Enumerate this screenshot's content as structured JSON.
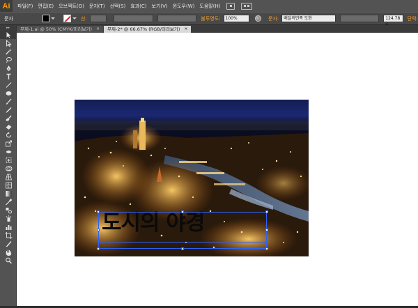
{
  "app": {
    "logo": "Ai",
    "menu": [
      "파일(F)",
      "편집(E)",
      "오브젝트(O)",
      "문자(T)",
      "선택(S)",
      "효과(C)",
      "보기(V)",
      "윈도우(W)",
      "도움말(H)"
    ]
  },
  "control": {
    "mode_label": "문자",
    "stroke_label": "선:",
    "opacity_label": "불투명도:",
    "opacity_value": "100%",
    "char_label": "문자:",
    "font_value": "배달의민족 도현",
    "size_value": "124.78 p",
    "para_label": "단락:"
  },
  "tabs": [
    {
      "label": "무제-1.ai @ 50% (CMYK/미리보기)",
      "close": "×",
      "active": false
    },
    {
      "label": "무제-2* @ 66.67% (RGB/미리보기)",
      "close": "×",
      "active": true
    }
  ],
  "document": {
    "headline": "도시의 야경"
  },
  "colors": {
    "fill": "#000000",
    "stroke": "none",
    "accent": "#2b62ff",
    "ui_dark": "#535353"
  },
  "tools": [
    "selection-tool",
    "direct-selection-tool",
    "magic-wand-tool",
    "lasso-tool",
    "pen-tool",
    "type-tool",
    "line-tool",
    "ellipse-tool",
    "paintbrush-tool",
    "pencil-tool",
    "blob-brush-tool",
    "eraser-tool",
    "rotate-tool",
    "scale-tool",
    "width-tool",
    "free-transform-tool",
    "shape-builder-tool",
    "perspective-grid-tool",
    "mesh-tool",
    "gradient-tool",
    "eyedropper-tool",
    "blend-tool",
    "symbol-sprayer-tool",
    "column-graph-tool",
    "artboard-tool",
    "slice-tool",
    "hand-tool",
    "zoom-tool"
  ]
}
